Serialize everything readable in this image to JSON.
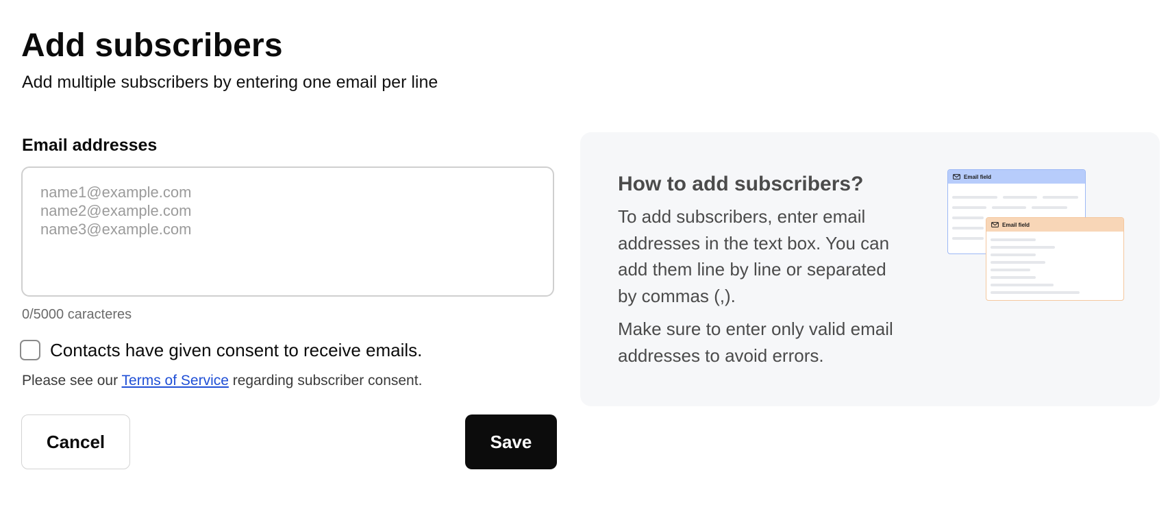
{
  "header": {
    "title": "Add subscribers",
    "subtitle": "Add multiple subscribers by entering one email per line"
  },
  "form": {
    "email_label": "Email addresses",
    "email_placeholder": "name1@example.com\nname2@example.com\nname3@example.com",
    "email_value": "",
    "char_counter": "0/5000 caracteres",
    "consent_label": "Contacts have given consent to receive emails.",
    "consent_checked": false,
    "terms_prefix": "Please see our ",
    "terms_link": "Terms of Service",
    "terms_suffix": " regarding subscriber consent.",
    "cancel_label": "Cancel",
    "save_label": "Save"
  },
  "help": {
    "title": "How to add subscribers?",
    "paragraph_1": "To add subscribers, enter email addresses in the text box. You can add them line by line or separated by commas (,).",
    "paragraph_2": "Make sure to enter only valid email addresses to avoid errors.",
    "illustration": {
      "card_1_label": "Email field",
      "card_2_label": "Email field",
      "card_1_icon": "mail-icon",
      "card_2_icon": "mail-icon"
    }
  },
  "colors": {
    "primary_button": "#0c0c0c",
    "link": "#1f4fd6",
    "panel_background": "#f6f7f9",
    "illustration_blue": "#b7ccfb",
    "illustration_orange": "#f8d6b7"
  }
}
